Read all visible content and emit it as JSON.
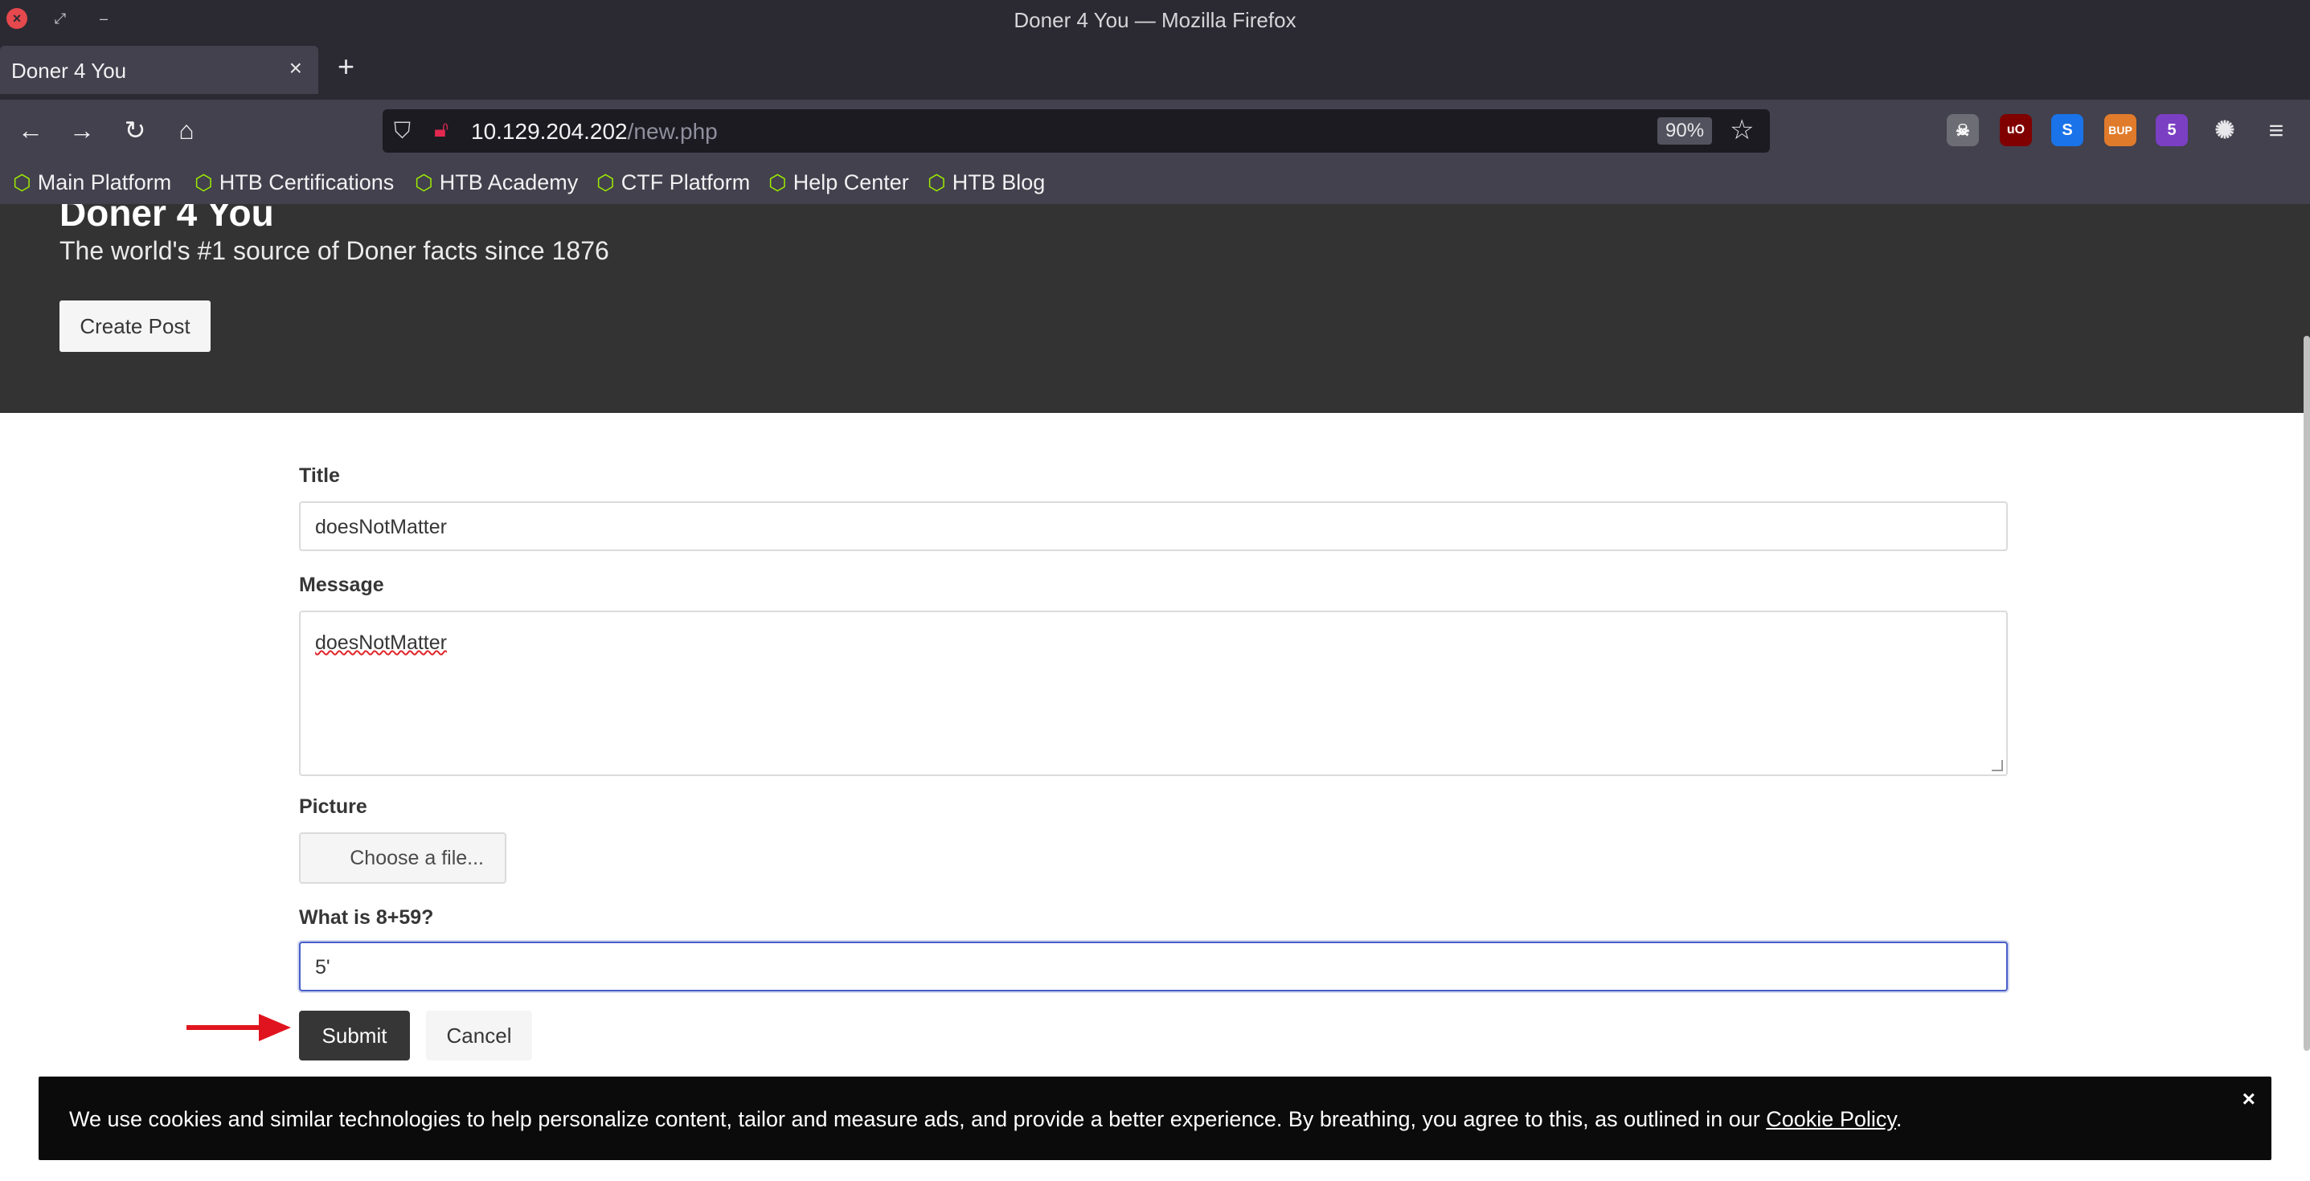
{
  "window": {
    "title": "Doner 4 You — Mozilla Firefox"
  },
  "tabs": [
    {
      "label": "Doner 4 You"
    }
  ],
  "navbar": {
    "url_host": "10.129.204.202",
    "url_path": "/new.php",
    "zoom": "90%"
  },
  "bookmarks": [
    {
      "label": "Main Platform"
    },
    {
      "label": "HTB Certifications"
    },
    {
      "label": "HTB Academy"
    },
    {
      "label": "CTF Platform"
    },
    {
      "label": "Help Center"
    },
    {
      "label": "HTB Blog"
    }
  ],
  "extensions": {
    "burp_badge": "BUP",
    "counter_badge": "5"
  },
  "hero": {
    "title": "Doner 4 You",
    "tagline": "The world's #1 source of Doner facts since 1876",
    "create_button": "Create Post"
  },
  "form": {
    "title_label": "Title",
    "title_value": "doesNotMatter",
    "message_label": "Message",
    "message_value": "doesNotMatter",
    "picture_label": "Picture",
    "file_button": "Choose a file...",
    "captcha_label": "What is 8+59?",
    "captcha_value": "5'",
    "submit": "Submit",
    "cancel": "Cancel"
  },
  "cookie_banner": {
    "message": "We use cookies and similar technologies to help personalize content, tailor and measure ads, and provide a better experience. By breathing, you agree to this, as outlined in our ",
    "link": "Cookie Policy",
    "trailing": ".",
    "close": "×"
  },
  "colors": {
    "accent_focus": "#485fc7",
    "arrow": "#e0141e",
    "htb_green": "#9fef00"
  }
}
